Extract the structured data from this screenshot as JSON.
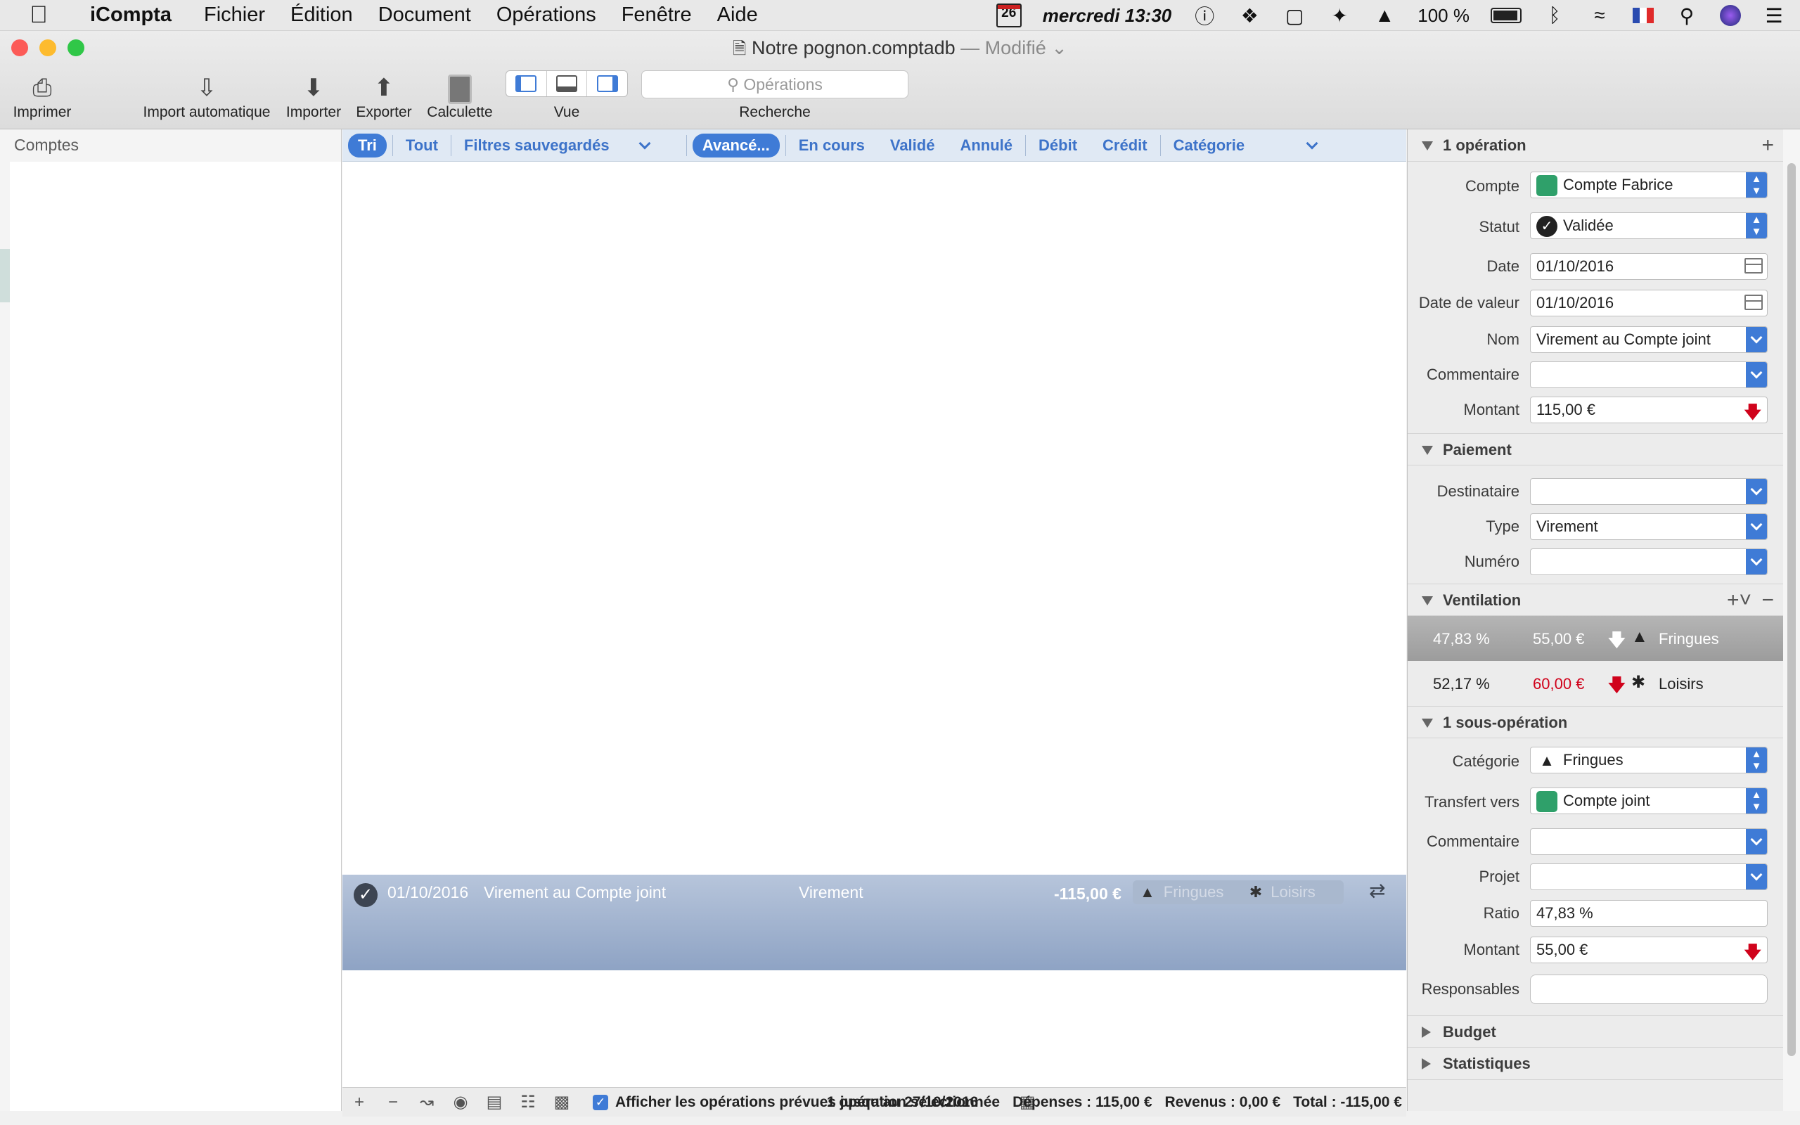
{
  "menubar": {
    "apple": "",
    "app": "iCompta",
    "items": [
      "Fichier",
      "Édition",
      "Document",
      "Opérations",
      "Fenêtre",
      "Aide"
    ],
    "cal_day": "26",
    "clock": "mercredi 13:30",
    "battery": "100 %"
  },
  "window": {
    "title": "Notre pognon.comptadb",
    "status": "— Modifié"
  },
  "toolbar": {
    "print": "Imprimer",
    "import_auto": "Import automatique",
    "import": "Importer",
    "export": "Exporter",
    "calculette": "Calculette",
    "view": "Vue",
    "search_placeholder": "Opérations",
    "search_label": "Recherche"
  },
  "sidebar": {
    "title": "Comptes"
  },
  "filters": {
    "tri": "Tri",
    "tout": "Tout",
    "saved": "Filtres sauvegardés",
    "advanced": "Avancé...",
    "en_cours": "En cours",
    "valide": "Validé",
    "annule": "Annulé",
    "debit": "Débit",
    "credit": "Crédit",
    "categorie": "Catégorie"
  },
  "operation": {
    "date": "01/10/2016",
    "name": "Virement au Compte joint",
    "type": "Virement",
    "amount": "-115,00 €",
    "cat1": "Fringues",
    "cat2": "Loisirs"
  },
  "bottombar": {
    "show_planned": "Afficher les opérations prévues jusqu'au 27/10/2016",
    "selected": "1 opération sélectionnée",
    "depenses": "Dépenses : 115,00 €",
    "revenus": "Revenus : 0,00 €",
    "total": "Total : -115,00 €"
  },
  "inspector": {
    "section_op": "1 opération",
    "compte_label": "Compte",
    "compte": "Compte Fabrice",
    "statut_label": "Statut",
    "statut": "Validée",
    "date_label": "Date",
    "date": "01/10/2016",
    "date_valeur_label": "Date de valeur",
    "date_valeur": "01/10/2016",
    "nom_label": "Nom",
    "nom": "Virement au Compte joint",
    "commentaire_label": "Commentaire",
    "commentaire": "",
    "montant_label": "Montant",
    "montant": "115,00 €",
    "section_paiement": "Paiement",
    "destinataire_label": "Destinataire",
    "destinataire": "",
    "type_label": "Type",
    "type": "Virement",
    "numero_label": "Numéro",
    "numero": "",
    "section_ventilation": "Ventilation",
    "ventilation": [
      {
        "pct": "47,83 %",
        "amount": "55,00 €",
        "cat": "Fringues"
      },
      {
        "pct": "52,17 %",
        "amount": "60,00 €",
        "cat": "Loisirs"
      }
    ],
    "section_sousop": "1 sous-opération",
    "categorie_label": "Catégorie",
    "categorie": "Fringues",
    "transfert_label": "Transfert vers",
    "transfert": "Compte joint",
    "commentaire2_label": "Commentaire",
    "commentaire2": "",
    "projet_label": "Projet",
    "projet": "",
    "ratio_label": "Ratio",
    "ratio": "47,83 %",
    "montant2_label": "Montant",
    "montant2": "55,00 €",
    "responsables_label": "Responsables",
    "responsables": "",
    "section_budget": "Budget",
    "section_stats": "Statistiques"
  },
  "colors": {
    "accent": "#3f7bd6",
    "debit_red": "#d0021b",
    "selection_row": "#9fb1cf"
  }
}
